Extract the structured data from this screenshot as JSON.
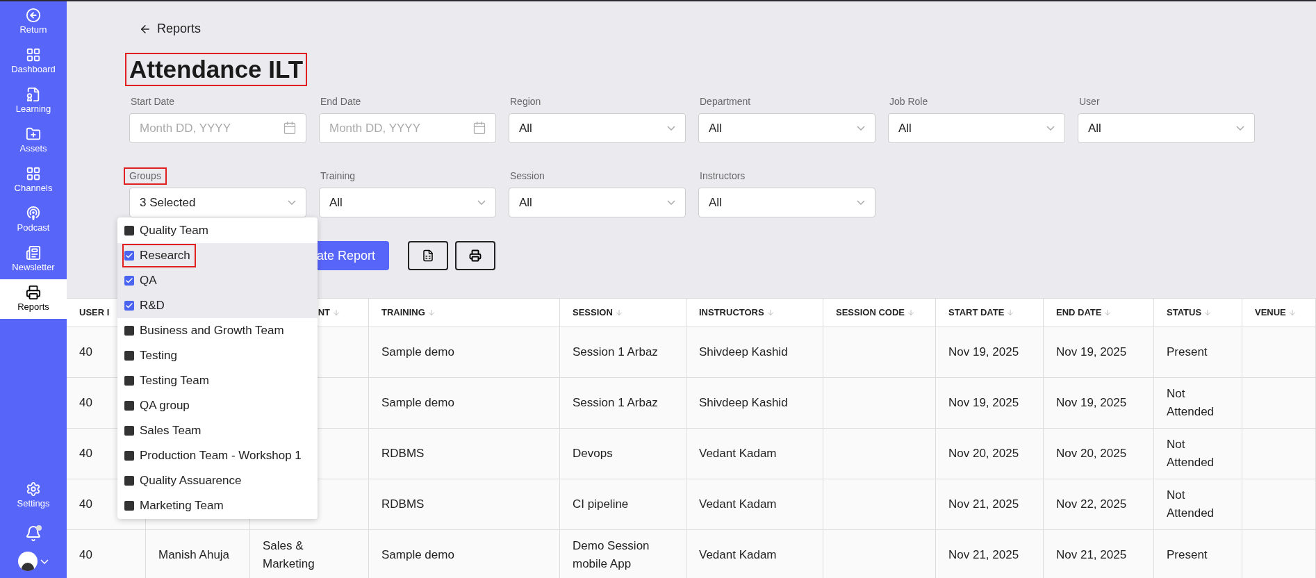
{
  "sidebar": {
    "items": [
      {
        "label": "Return",
        "kind": "return",
        "selected": false
      },
      {
        "label": "Dashboard",
        "kind": "grid",
        "selected": false
      },
      {
        "label": "Learning",
        "kind": "learning",
        "selected": false
      },
      {
        "label": "Assets",
        "kind": "folder",
        "selected": false
      },
      {
        "label": "Channels",
        "kind": "grid",
        "selected": false
      },
      {
        "label": "Podcast",
        "kind": "podcast",
        "selected": false
      },
      {
        "label": "Newsletter",
        "kind": "newsletter",
        "selected": false
      },
      {
        "label": "Reports",
        "kind": "printer",
        "selected": true
      }
    ],
    "bottom": [
      {
        "label": "Settings",
        "kind": "settings"
      }
    ]
  },
  "back_link": "Reports",
  "title": {
    "text": "Attendance ILT",
    "highlighted": true
  },
  "filters": [
    [
      {
        "label": "Start Date",
        "kind": "date",
        "placeholder": "Month DD, YYYY",
        "highlighted": false
      },
      {
        "label": "End Date",
        "kind": "date",
        "placeholder": "Month DD, YYYY",
        "highlighted": false
      },
      {
        "label": "Region",
        "kind": "select",
        "value": "All",
        "highlighted": false
      },
      {
        "label": "Department",
        "kind": "select",
        "value": "All",
        "highlighted": false
      },
      {
        "label": "Job Role",
        "kind": "select",
        "value": "All",
        "highlighted": false
      },
      {
        "label": "User",
        "kind": "select",
        "value": "All",
        "highlighted": false
      }
    ],
    [
      {
        "label": "Groups",
        "kind": "select",
        "value": "3 Selected",
        "highlighted": true
      },
      {
        "label": "Training",
        "kind": "select",
        "value": "All",
        "highlighted": false
      },
      {
        "label": "Session",
        "kind": "select",
        "value": "All",
        "highlighted": false
      },
      {
        "label": "Instructors",
        "kind": "select",
        "value": "All",
        "highlighted": false
      }
    ]
  ],
  "groups_dropdown": [
    {
      "label": "Quality Team",
      "checked": false,
      "highlighted": false
    },
    {
      "label": "Research",
      "checked": true,
      "highlighted": true
    },
    {
      "label": "QA",
      "checked": true,
      "highlighted": false
    },
    {
      "label": "R&D",
      "checked": true,
      "highlighted": false
    },
    {
      "label": "Business and Growth Team",
      "checked": false,
      "highlighted": false
    },
    {
      "label": "Testing",
      "checked": false,
      "highlighted": false
    },
    {
      "label": "Testing Team",
      "checked": false,
      "highlighted": false
    },
    {
      "label": "QA group",
      "checked": false,
      "highlighted": false
    },
    {
      "label": "Sales Team",
      "checked": false,
      "highlighted": false
    },
    {
      "label": "Production Team - Workshop 1",
      "checked": false,
      "highlighted": false
    },
    {
      "label": "Quality Assuarence",
      "checked": false,
      "highlighted": false
    },
    {
      "label": "Marketing Team",
      "checked": false,
      "highlighted": false
    }
  ],
  "generate_button": "ate Report",
  "table": {
    "columns": [
      "USER I",
      "",
      "NT",
      "TRAINING",
      "SESSION",
      "INSTRUCTORS",
      "SESSION CODE",
      "START DATE",
      "END DATE",
      "STATUS",
      "VENUE"
    ],
    "rows": [
      [
        "40",
        "",
        "",
        "Sample demo",
        "Session 1 Arbaz",
        "Shivdeep Kashid",
        "",
        "Nov 19, 2025",
        "Nov 19, 2025",
        "Present",
        ""
      ],
      [
        "40",
        "",
        "",
        "Sample demo",
        "Session 1 Arbaz",
        "Shivdeep Kashid",
        "",
        "Nov 19, 2025",
        "Nov 19, 2025",
        "Not Attended",
        ""
      ],
      [
        "40",
        "",
        "",
        "RDBMS",
        "Devops",
        "Vedant Kadam",
        "",
        "Nov 20, 2025",
        "Nov 20, 2025",
        "Not Attended",
        ""
      ],
      [
        "40",
        "",
        "",
        "RDBMS",
        "CI pipeline",
        "Vedant Kadam",
        "",
        "Nov 21, 2025",
        "Nov 22, 2025",
        "Not Attended",
        ""
      ],
      [
        "40",
        "Manish Ahuja",
        "Sales & Marketing",
        "Sample demo",
        "Demo Session mobile App",
        "Vedant Kadam",
        "",
        "Nov 21, 2025",
        "Nov 21, 2025",
        "Present",
        ""
      ]
    ]
  }
}
